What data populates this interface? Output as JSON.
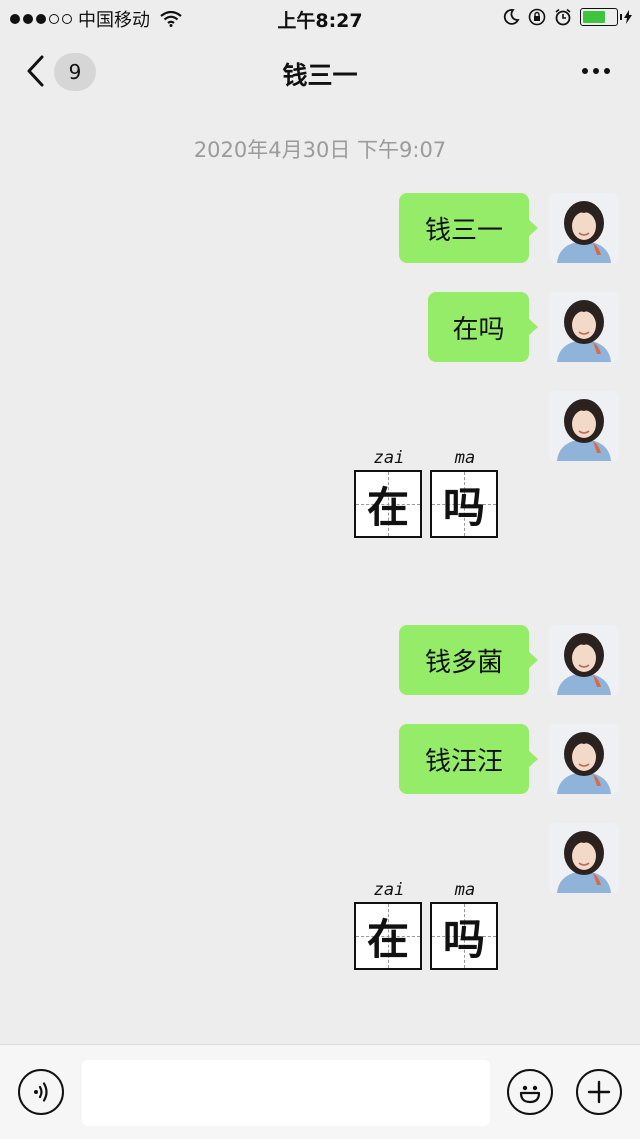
{
  "status_bar": {
    "carrier": "中国移动",
    "time": "上午8:27",
    "battery_level": 0.7
  },
  "nav": {
    "unread_count": "9",
    "title": "钱三一"
  },
  "timestamp": "2020年4月30日 下午9:07",
  "messages": [
    {
      "type": "text",
      "text": "钱三一"
    },
    {
      "type": "text",
      "text": "在吗"
    },
    {
      "type": "sticker",
      "pinyin_1": "zai",
      "pinyin_2": "ma",
      "char_1": "在",
      "char_2": "吗"
    },
    {
      "type": "text",
      "text": "钱多菌"
    },
    {
      "type": "text",
      "text": "钱汪汪"
    },
    {
      "type": "sticker",
      "pinyin_1": "zai",
      "pinyin_2": "ma",
      "char_1": "在",
      "char_2": "吗"
    }
  ],
  "input_bar": {
    "voice_icon": "voice-icon",
    "emoji_icon": "emoji-icon",
    "plus_icon": "plus-icon",
    "input_value": ""
  },
  "colors": {
    "background": "#ededed",
    "bubble": "#95ec69",
    "battery": "#3ec43e"
  }
}
